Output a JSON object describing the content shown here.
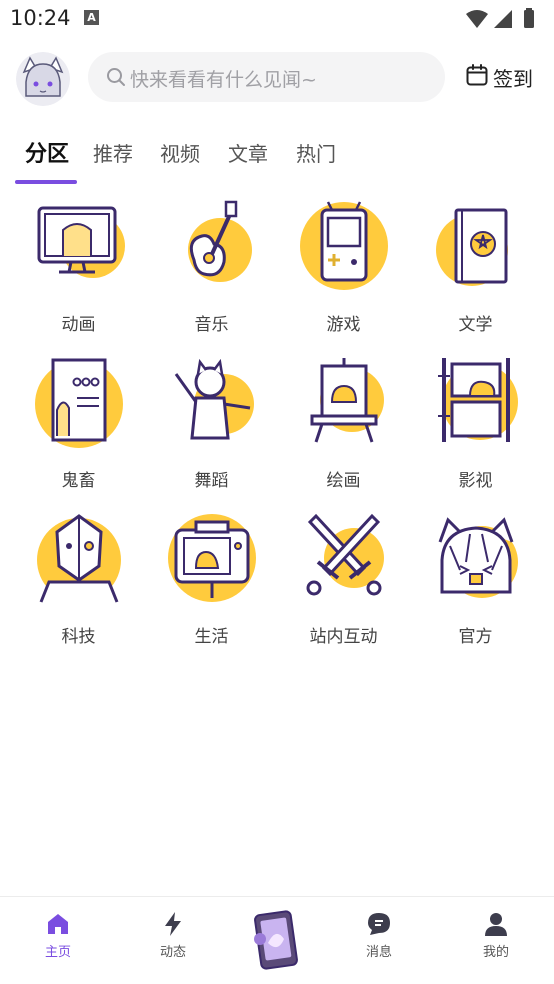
{
  "status": {
    "time": "10:24",
    "notif_icon": "A"
  },
  "header": {
    "search_placeholder": "快来看看有什么见闻~",
    "checkin_label": "签到"
  },
  "tabs": [
    {
      "label": "分区",
      "active": true
    },
    {
      "label": "推荐",
      "active": false
    },
    {
      "label": "视频",
      "active": false
    },
    {
      "label": "文章",
      "active": false
    },
    {
      "label": "热门",
      "active": false
    }
  ],
  "categories": [
    {
      "label": "动画",
      "icon": "monitor-anime-icon"
    },
    {
      "label": "音乐",
      "icon": "guitar-icon"
    },
    {
      "label": "游戏",
      "icon": "gameboy-icon"
    },
    {
      "label": "文学",
      "icon": "book-icon"
    },
    {
      "label": "鬼畜",
      "icon": "poster-icon"
    },
    {
      "label": "舞蹈",
      "icon": "dancing-cat-icon"
    },
    {
      "label": "绘画",
      "icon": "easel-icon"
    },
    {
      "label": "影视",
      "icon": "film-strip-icon"
    },
    {
      "label": "科技",
      "icon": "cyborg-icon"
    },
    {
      "label": "生活",
      "icon": "camera-icon"
    },
    {
      "label": "站内互动",
      "icon": "crossed-swords-icon"
    },
    {
      "label": "官方",
      "icon": "cat-girl-icon"
    }
  ],
  "bottom_nav": [
    {
      "label": "主页",
      "icon": "home-icon",
      "active": true
    },
    {
      "label": "动态",
      "icon": "lightning-icon",
      "active": false
    },
    {
      "label": "消息",
      "icon": "message-icon",
      "active": false
    },
    {
      "label": "我的",
      "icon": "user-icon",
      "active": false
    }
  ],
  "colors": {
    "accent": "#7a4de0",
    "icon_yellow": "#ffcb3d",
    "icon_line": "#3b2a6b",
    "search_bg": "#f4f4f5"
  }
}
